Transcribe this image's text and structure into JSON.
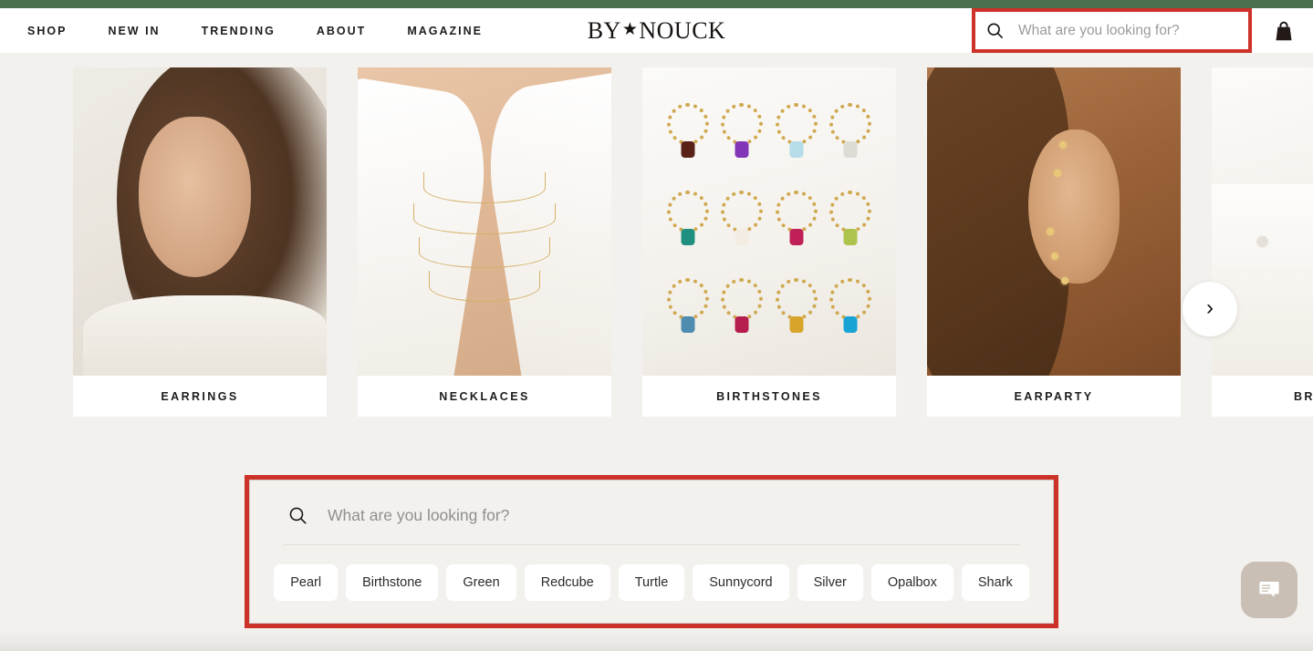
{
  "announcement": {
    "color": "#4a7050"
  },
  "header": {
    "nav": [
      {
        "label": "SHOP",
        "name": "nav-item-shop"
      },
      {
        "label": "NEW IN",
        "name": "nav-item-new-in"
      },
      {
        "label": "TRENDING",
        "name": "nav-item-trending"
      },
      {
        "label": "ABOUT",
        "name": "nav-item-about"
      },
      {
        "label": "MAGAZINE",
        "name": "nav-item-magazine"
      }
    ],
    "logo": {
      "prefix": "BY",
      "star": "★",
      "suffix": "NOUCK"
    },
    "search": {
      "placeholder": "What are you looking for?",
      "value": "",
      "icon": "search-icon",
      "highlight_color": "#cd3228"
    },
    "cart": {
      "icon": "shopping-bag-icon"
    }
  },
  "carousel": {
    "next_label": "›",
    "cards": [
      {
        "label": "EARRINGS"
      },
      {
        "label": "NECKLACES"
      },
      {
        "label": "BIRTHSTONES"
      },
      {
        "label": "EARPARTY"
      },
      {
        "label": "BRACELETS"
      }
    ]
  },
  "search_panel": {
    "highlight_color": "#cd3228",
    "search": {
      "placeholder": "What are you looking for?",
      "value": "",
      "icon": "search-icon"
    },
    "tags": [
      {
        "label": "Pearl"
      },
      {
        "label": "Birthstone"
      },
      {
        "label": "Green"
      },
      {
        "label": "Redcube"
      },
      {
        "label": "Turtle"
      },
      {
        "label": "Sunnycord"
      },
      {
        "label": "Silver"
      },
      {
        "label": "Opalbox"
      },
      {
        "label": "Shark"
      }
    ]
  },
  "chat": {
    "icon": "chat-bubble-icon",
    "color": "#c9bfb4"
  }
}
